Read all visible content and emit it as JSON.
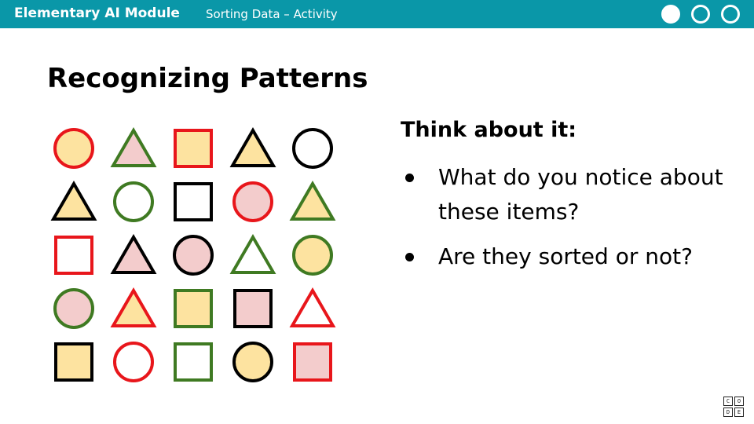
{
  "header": {
    "module_title": "Elementary AI Module",
    "activity_title": "Sorting Data – Activity",
    "progress": {
      "total": 3,
      "current": 1
    }
  },
  "title": "Recognizing Patterns",
  "think": {
    "heading": "Think about it:",
    "bullets": [
      "What do you notice about these items?",
      "Are they sorted or not?"
    ]
  },
  "colors": {
    "header_bg": "#0a97a8",
    "red": "#e8161b",
    "green": "#3f7a22",
    "black": "#000000",
    "yellow_fill": "#fde3a0",
    "pink_fill": "#f3cccc",
    "white_fill": "#ffffff"
  },
  "shapes": [
    [
      {
        "shape": "circle",
        "stroke": "red",
        "fill": "yellow"
      },
      {
        "shape": "triangle",
        "stroke": "green",
        "fill": "pink"
      },
      {
        "shape": "square",
        "stroke": "red",
        "fill": "yellow"
      },
      {
        "shape": "triangle",
        "stroke": "black",
        "fill": "yellow"
      },
      {
        "shape": "circle",
        "stroke": "black",
        "fill": "white"
      }
    ],
    [
      {
        "shape": "triangle",
        "stroke": "black",
        "fill": "yellow"
      },
      {
        "shape": "circle",
        "stroke": "green",
        "fill": "white"
      },
      {
        "shape": "square",
        "stroke": "black",
        "fill": "white"
      },
      {
        "shape": "circle",
        "stroke": "red",
        "fill": "pink"
      },
      {
        "shape": "triangle",
        "stroke": "green",
        "fill": "yellow"
      }
    ],
    [
      {
        "shape": "square",
        "stroke": "red",
        "fill": "white"
      },
      {
        "shape": "triangle",
        "stroke": "black",
        "fill": "pink"
      },
      {
        "shape": "circle",
        "stroke": "black",
        "fill": "pink"
      },
      {
        "shape": "triangle",
        "stroke": "green",
        "fill": "white"
      },
      {
        "shape": "circle",
        "stroke": "green",
        "fill": "yellow"
      }
    ],
    [
      {
        "shape": "circle",
        "stroke": "green",
        "fill": "pink"
      },
      {
        "shape": "triangle",
        "stroke": "red",
        "fill": "yellow"
      },
      {
        "shape": "square",
        "stroke": "green",
        "fill": "yellow"
      },
      {
        "shape": "square",
        "stroke": "black",
        "fill": "pink"
      },
      {
        "shape": "triangle",
        "stroke": "red",
        "fill": "white"
      }
    ],
    [
      {
        "shape": "square",
        "stroke": "black",
        "fill": "yellow"
      },
      {
        "shape": "circle",
        "stroke": "red",
        "fill": "white"
      },
      {
        "shape": "square",
        "stroke": "green",
        "fill": "white"
      },
      {
        "shape": "circle",
        "stroke": "black",
        "fill": "yellow"
      },
      {
        "shape": "square",
        "stroke": "red",
        "fill": "pink"
      }
    ]
  ],
  "logo": {
    "letters": [
      "C",
      "O",
      "D",
      "E"
    ],
    "icon": "code-org-logo-icon"
  }
}
